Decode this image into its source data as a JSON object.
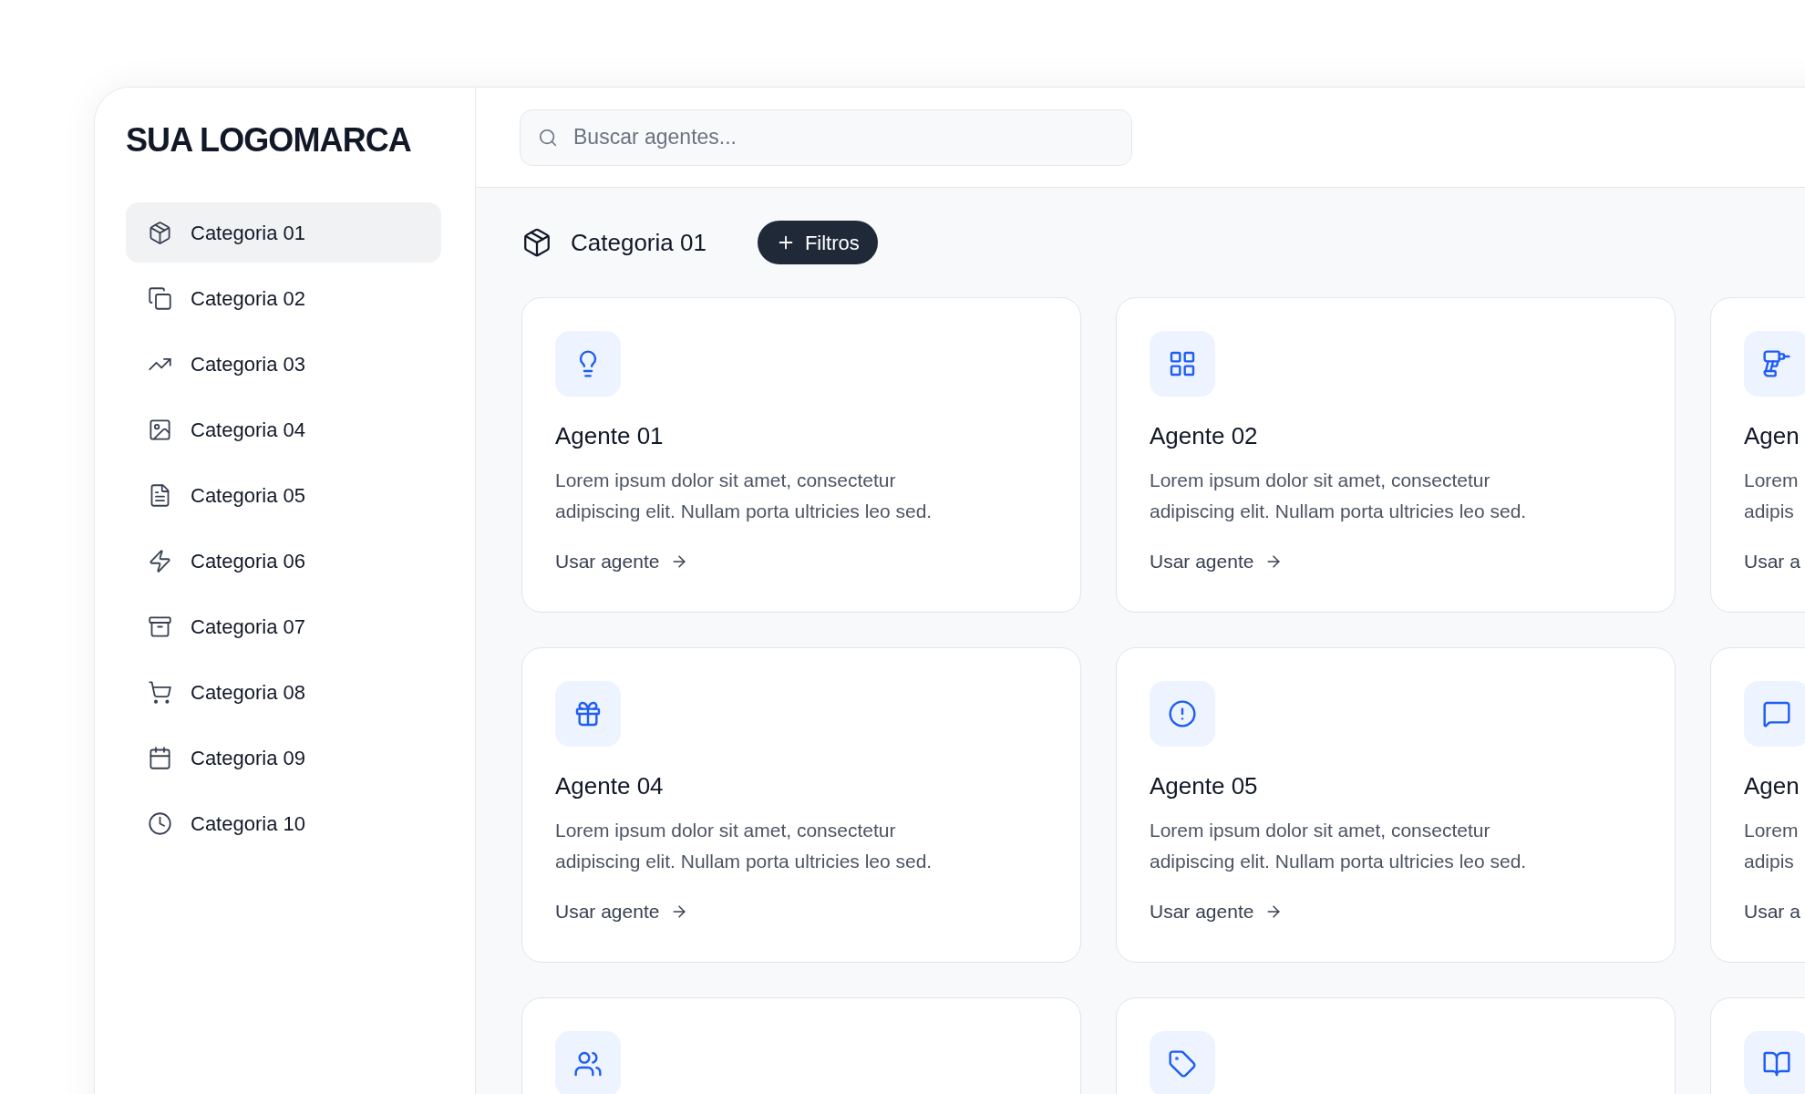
{
  "logo": "SUA LOGOMARCA",
  "sidebar": {
    "items": [
      {
        "label": "Categoria 01",
        "selected": true
      },
      {
        "label": "Categoria 02",
        "selected": false
      },
      {
        "label": "Categoria 03",
        "selected": false
      },
      {
        "label": "Categoria 04",
        "selected": false
      },
      {
        "label": "Categoria 05",
        "selected": false
      },
      {
        "label": "Categoria 06",
        "selected": false
      },
      {
        "label": "Categoria 07",
        "selected": false
      },
      {
        "label": "Categoria 08",
        "selected": false
      },
      {
        "label": "Categoria 09",
        "selected": false
      },
      {
        "label": "Categoria 10",
        "selected": false
      }
    ]
  },
  "search": {
    "placeholder": "Buscar agentes..."
  },
  "heading": "Categoria 01",
  "filter_button": "Filtros",
  "cards": [
    {
      "kind": "full",
      "title": "Agente 01",
      "description": [
        "Lorem ipsum dolor sit amet, consectetur",
        "adipiscing elit. Nullam porta ultricies leo sed."
      ],
      "link": "Usar agente"
    },
    {
      "kind": "full",
      "title": "Agente 02",
      "description": [
        "Lorem ipsum dolor sit amet, consectetur",
        "adipiscing elit. Nullam porta ultricies leo sed."
      ],
      "link": "Usar agente"
    },
    {
      "kind": "full",
      "title": "Agen",
      "description": [
        "Lorem",
        "adipis"
      ],
      "link": "Usar a"
    },
    {
      "kind": "full",
      "title": "Agente 04",
      "description": [
        "Lorem ipsum dolor sit amet, consectetur",
        "adipiscing elit. Nullam porta ultricies leo sed."
      ],
      "link": "Usar agente"
    },
    {
      "kind": "full",
      "title": "Agente 05",
      "description": [
        "Lorem ipsum dolor sit amet, consectetur",
        "adipiscing elit. Nullam porta ultricies leo sed."
      ],
      "link": "Usar agente"
    },
    {
      "kind": "full",
      "title": "Agen",
      "description": [
        "Lorem",
        "adipis"
      ],
      "link": "Usar a"
    },
    {
      "kind": "icon_only"
    },
    {
      "kind": "icon_only"
    },
    {
      "kind": "icon_only"
    }
  ]
}
